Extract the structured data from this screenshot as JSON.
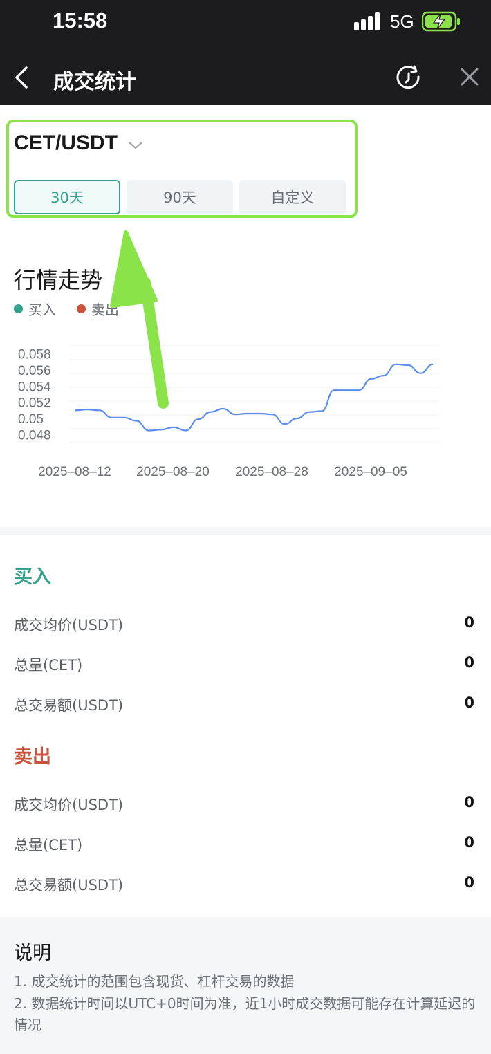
{
  "status_bar": {
    "time": "15:58",
    "network": "5G"
  },
  "nav": {
    "title": "成交统计"
  },
  "pair_selector": {
    "pair": "CET/USDT"
  },
  "range_tabs": [
    {
      "label": "30天",
      "active": true
    },
    {
      "label": "90天",
      "active": false
    },
    {
      "label": "自定义",
      "active": false
    }
  ],
  "trend": {
    "title": "行情走势",
    "legend": [
      {
        "label": "买入",
        "color": "#36a38f"
      },
      {
        "label": "卖出",
        "color": "#c9533d"
      }
    ]
  },
  "chart_data": {
    "type": "line",
    "y_ticks": [
      "0.048",
      "0.05",
      "0.052",
      "0.054",
      "0.056",
      "0.058"
    ],
    "x_ticks": [
      "2025–08–12",
      "2025–08–20",
      "2025–08–28",
      "2025–09–05"
    ],
    "ylim": [
      0.047,
      0.059
    ],
    "grid": true,
    "series": [
      {
        "color": "#5b8def",
        "values": [
          0.051,
          0.0511,
          0.051,
          0.0501,
          0.0501,
          0.0497,
          0.0485,
          0.0486,
          0.0489,
          0.0485,
          0.0499,
          0.0508,
          0.0512,
          0.0505,
          0.0506,
          0.0506,
          0.0505,
          0.0493,
          0.05,
          0.0508,
          0.0509,
          0.0535,
          0.0535,
          0.0535,
          0.0549,
          0.0553,
          0.0567,
          0.0566,
          0.0556,
          0.0567
        ]
      }
    ]
  },
  "buy": {
    "title": "买入",
    "color": "#36a38f",
    "rows": [
      {
        "label": "成交均价(USDT)",
        "value": "0"
      },
      {
        "label": "总量(CET)",
        "value": "0"
      },
      {
        "label": "总交易额(USDT)",
        "value": "0"
      }
    ]
  },
  "sell": {
    "title": "卖出",
    "color": "#c9533d",
    "rows": [
      {
        "label": "成交均价(USDT)",
        "value": "0"
      },
      {
        "label": "总量(CET)",
        "value": "0"
      },
      {
        "label": "总交易额(USDT)",
        "value": "0"
      }
    ]
  },
  "notes": {
    "title": "说明",
    "items": [
      "1. 成交统计的范围包含现货、杠杆交易的数据",
      "2. 数据统计时间以UTC+0时间为准，近1小时成交数据可能存在计算延迟的情况"
    ]
  }
}
